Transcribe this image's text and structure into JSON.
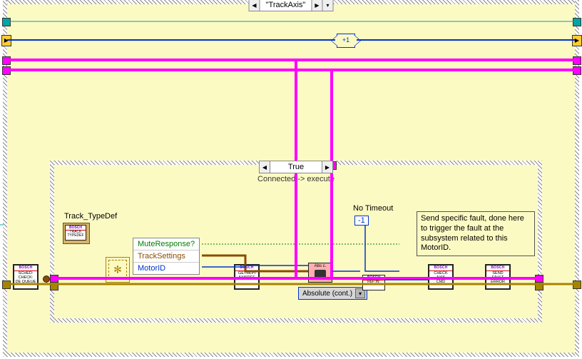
{
  "outer_case": {
    "selector_label": "\"TrackAxis\"",
    "increment_label": "+1"
  },
  "inner_case": {
    "selector_label": "True",
    "subtitle": "Connected -> execute"
  },
  "no_timeout": {
    "title": "No Timeout",
    "value": "-1"
  },
  "comment": "Send specific fault, done here to trigger the fault at the subsystem related to this MotorID.",
  "track_typedef_label": "Track_TypeDef",
  "unbundle_items": {
    "mute": "MuteResponse?",
    "settings": "TrackSettings",
    "motor": "MotorID"
  },
  "ring_label": "Absolute (cont.)",
  "poly_label": "Abs c.",
  "brand": "BOSCH",
  "vi": {
    "typedef_mini": "TRACK\nTYPEDEF",
    "dequeue": "SCHED:\nCHECK:\nDE QUEUE",
    "getmlpi": "GETMLPI\nAXISREF",
    "refine": "REF:IN:",
    "checkaxis": "CHECK\nAXIS\nCMD",
    "sendfault": "SEND\nFAULT\nERROR"
  }
}
